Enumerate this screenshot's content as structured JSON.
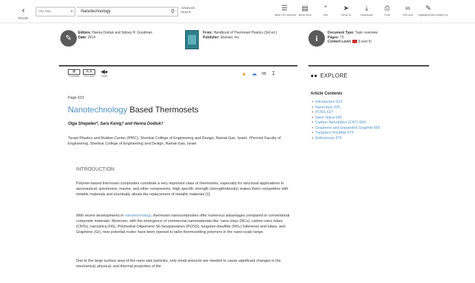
{
  "toolbar": {
    "results_label": "Results",
    "search_scope": "This Title",
    "search_value": "Nanotechnology",
    "advanced_search": [
      "Advanced",
      "Search"
    ],
    "tools": [
      {
        "icon": "toc-icon",
        "glyph": "☰",
        "label": "Table Of Contents"
      },
      {
        "icon": "book-view-icon",
        "glyph": "▤",
        "label": "Book View"
      },
      {
        "icon": "cite-icon",
        "glyph": "“",
        "label": "Cite"
      },
      {
        "icon": "send-icon",
        "glyph": "➤",
        "label": "Send To"
      },
      {
        "icon": "download-icon",
        "glyph": "⤓",
        "label": "Download"
      },
      {
        "icon": "print-icon",
        "glyph": "⎙",
        "label": "Print"
      },
      {
        "icon": "link-icon",
        "glyph": "∞",
        "label": "Get Link"
      },
      {
        "icon": "highlight-icon",
        "glyph": "✎",
        "label": "Highlights And Notes (0)"
      }
    ]
  },
  "info": {
    "editors_label": "Editors:",
    "editors_value": "Hanna Dodiuk and Sidney H. Goodman",
    "date_label": "Date:",
    "date_value": "2014",
    "from_label": "From:",
    "from_value": "Handbook of Thermoset Plastics (3rd ed.)",
    "publisher_label": "Publisher:",
    "publisher_value": "Elsevier, Inc.",
    "doctype_label": "Document Type:",
    "doctype_value": "Topic overview",
    "pages_label": "Pages:",
    "pages_value": "73",
    "level_label": "Content Level:",
    "level_value": "(Level 5)"
  },
  "aux_tools": [
    {
      "icon": "translate-icon",
      "glyph": "≣",
      "label": "Translate"
    },
    {
      "icon": "font-size-icon",
      "glyph": "A A",
      "label": "Font Size"
    },
    {
      "icon": "listen-icon",
      "glyph": "◀⦁",
      "label": "Listen"
    }
  ],
  "article": {
    "page": "Page 623",
    "title_highlight": "Nanotechnology",
    "title_rest": " Based Thermosets",
    "authors": "Olga Shepelev*, Sara Kenig† and Hanna Dodiuk†",
    "affiliation": "*Israel Plastics and Rubber Center (IPRC), Shenkar College of Engineering and Design, Ramat-Gan, Israel; †Pernick Faculty of Engineering, Shenkar College of Engineering and Design, Ramat-Gan, Israel",
    "intro_heading": "INTRODUCTION",
    "p1": "Polymer-based thermoset composites constitute a very important class of thermosets, especially for structural applications in aeronautical, automotive, marine, and other components. High specific strength (strength/density) makes them competitive with metallic materials and eventually allows the replacement of metallic materials [1].",
    "p2_a": "With recent developments in ",
    "p2_link": "nanotechnology",
    "p2_b": ", thermoset nanocomposites offer numerous advantages compared to conventional composite materials. Moreover, with the emergence of commercial nanomaterials like: nano clays (NCs), carbon nano tubes (CNTs), nanosilica (NS), Polyhedral-Oligomeric-Sil-Sesquioxanes (POSS), tungsten-disulfide (WS₂) fullerenes and tubes, and Graphene (Gr), new potential routes have been opened to tailor thermosetting polymers in the nano-scale range.",
    "p3": "Due to the large surface area of the nano size particles, only small amounts are needed to cause significant changes in the mechanical, physical, and thermal properties of the"
  },
  "explore": {
    "heading": "EXPLORE",
    "contents_heading": "Article Contents",
    "items": [
      "Introduction 623",
      "Nanoclays 625",
      "POSS 637",
      "Nano Silica 640",
      "Carbon Nanotubes (CNT) 654",
      "Graphene and Expanded Graphite 665",
      "Tungsten Disulfide 674",
      "References 675"
    ]
  },
  "colors": {
    "accent": "#4d8fc4",
    "level": "#c8302e",
    "cover": "#2e7f8a"
  }
}
